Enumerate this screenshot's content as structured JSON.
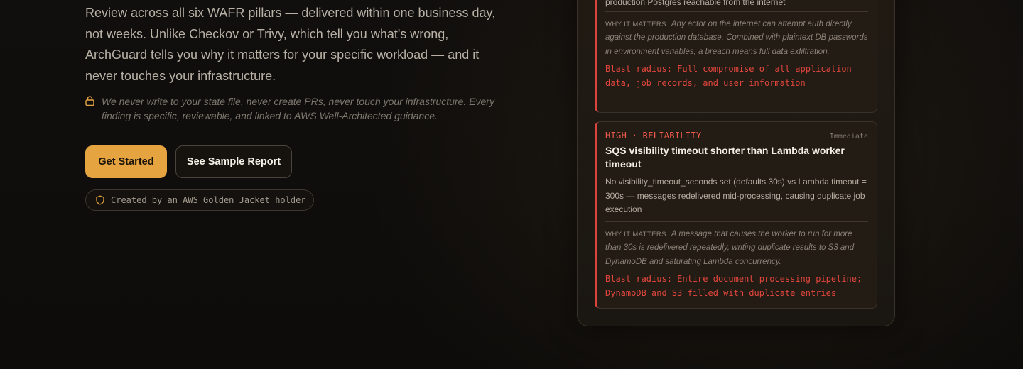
{
  "hero": {
    "description": "Review across all six WAFR pillars — delivered within one business day, not weeks. Unlike Checkov or Trivy, which tell you what's wrong, ArchGuard tells you why it matters for your specific workload — and it never touches your infrastructure.",
    "note": "We never write to your state file, never create PRs, never touch your infrastructure. Every finding is specific, reviewable, and linked to AWS Well-Architected guidance.",
    "primary_cta": "Get Started",
    "secondary_cta": "See Sample Report",
    "badge": "Created by an AWS Golden Jacket holder",
    "accent_color": "#e5a440"
  },
  "report": {
    "findings": [
      {
        "desc_partial": "production Postgres reachable from the internet",
        "why_label": "WHY IT MATTERS:",
        "why": "Any actor on the internet can attempt auth directly against the production database. Combined with plaintext DB passwords in environment variables, a breach means full data exfiltration.",
        "blast": "Blast radius: Full compromise of all application data, job records, and user information"
      },
      {
        "severity": "HIGH · RELIABILITY",
        "timing": "Immediate",
        "title": "SQS visibility timeout shorter than Lambda worker timeout",
        "desc": "No visibility_timeout_seconds set (defaults 30s) vs Lambda timeout = 300s — messages redelivered mid-processing, causing duplicate job execution",
        "why_label": "WHY IT MATTERS:",
        "why": "A message that causes the worker to run for more than 30s is redelivered repeatedly, writing duplicate results to S3 and DynamoDB and saturating Lambda concurrency.",
        "blast": "Blast radius: Entire document processing pipeline; DynamoDB and S3 filled with duplicate entries"
      }
    ],
    "severity_color": "#ef5a4a"
  }
}
